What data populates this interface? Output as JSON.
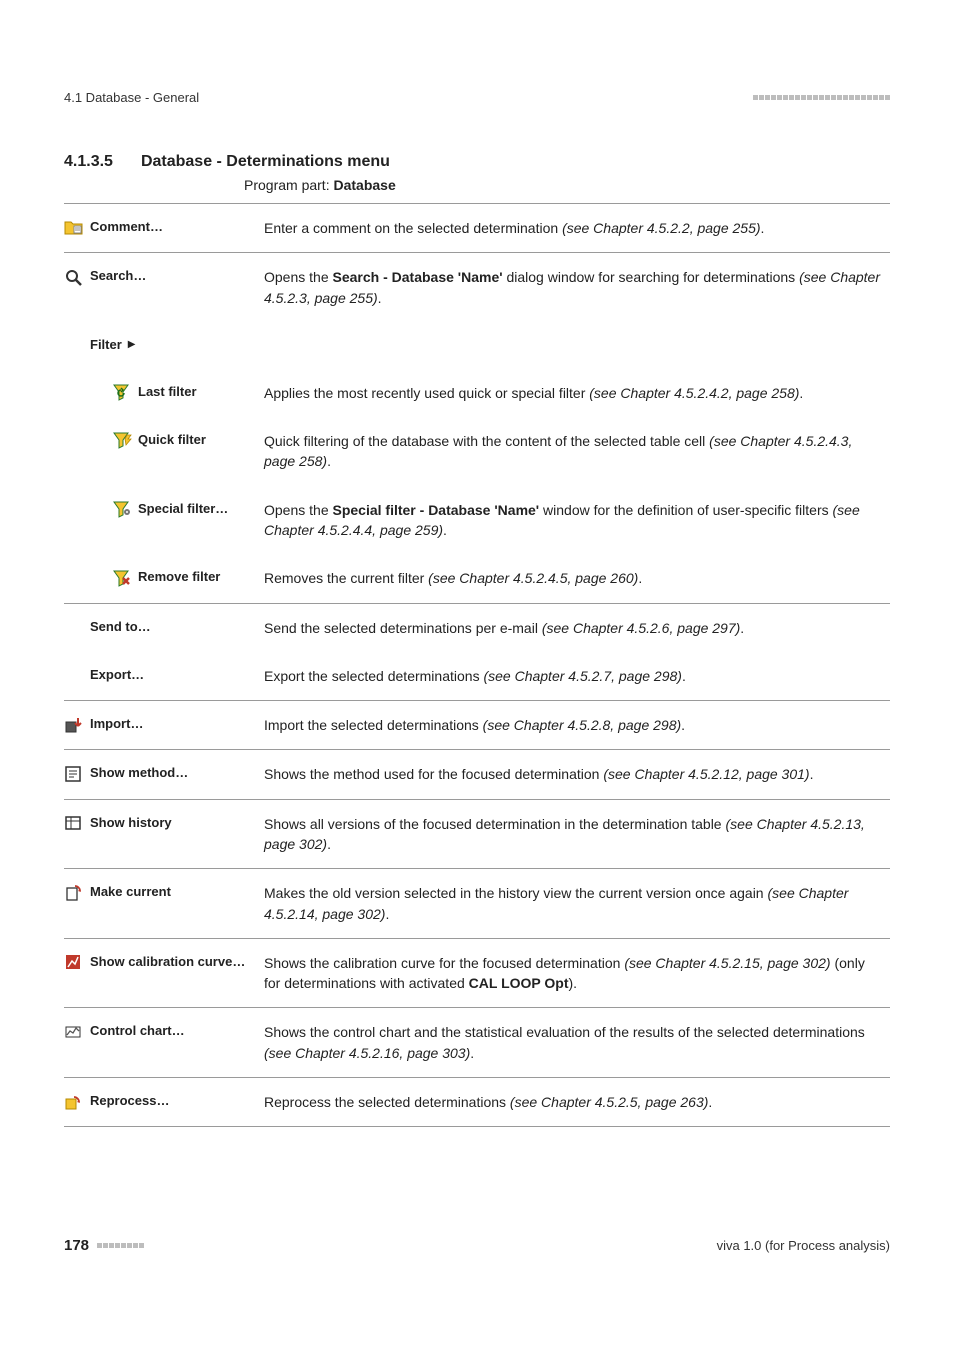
{
  "header": {
    "section_path": "4.1 Database - General"
  },
  "heading": {
    "number": "4.1.3.5",
    "title": "Database - Determinations menu"
  },
  "program_line": {
    "label": "Program part: ",
    "value": "Database"
  },
  "rows": [
    {
      "id": "comment",
      "label": "Comment…",
      "icon": "folder-note",
      "indent": 0,
      "desc_pre": "Enter a comment on the selected determination ",
      "desc_ital": "(see Chapter 4.5.2.2, page 255)",
      "desc_post": "."
    },
    {
      "id": "search",
      "label": "Search…",
      "icon": "magnifier",
      "indent": 0,
      "desc_pre": "Opens the ",
      "desc_bold": "Search - Database 'Name'",
      "desc_mid": " dialog window for searching for determinations ",
      "desc_ital": "(see Chapter 4.5.2.3, page 255)",
      "desc_post": "."
    },
    {
      "id": "filter",
      "label": "Filter ",
      "icon": "",
      "indent": 1,
      "triangle": true,
      "desc_pre": ""
    },
    {
      "id": "lastfilter",
      "label": "Last filter",
      "icon": "funnel-redo",
      "indent": 2,
      "desc_pre": "Applies the most recently used quick or special filter ",
      "desc_ital": "(see Chapter 4.5.2.4.2, page 258)",
      "desc_post": "."
    },
    {
      "id": "quickfilter",
      "label": "Quick filter",
      "icon": "funnel-bolt",
      "indent": 2,
      "desc_pre": "Quick filtering of the database with the content of the selected table cell ",
      "desc_ital": "(see Chapter 4.5.2.4.3, page 258)",
      "desc_post": "."
    },
    {
      "id": "specialfilter",
      "label": "Special filter…",
      "icon": "funnel-gear",
      "indent": 2,
      "desc_pre": "Opens the ",
      "desc_bold": "Special filter - Database 'Name'",
      "desc_mid": " window for the definition of user-specific filters ",
      "desc_ital": "(see Chapter 4.5.2.4.4, page 259)",
      "desc_post": "."
    },
    {
      "id": "removefilter",
      "label": "Remove filter",
      "icon": "funnel-x",
      "indent": 2,
      "desc_pre": "Removes the current filter ",
      "desc_ital": "(see Chapter 4.5.2.4.5, page 260)",
      "desc_post": "."
    },
    {
      "id": "sendto",
      "label": "Send to…",
      "icon": "",
      "indent": 1,
      "desc_pre": "Send the selected determinations per e-mail ",
      "desc_ital": "(see Chapter 4.5.2.6, page 297)",
      "desc_post": "."
    },
    {
      "id": "export",
      "label": "Export…",
      "icon": "",
      "indent": 1,
      "desc_pre": "Export the selected determinations ",
      "desc_ital": "(see Chapter 4.5.2.7, page 298)",
      "desc_post": "."
    },
    {
      "id": "import",
      "label": "Import…",
      "icon": "import",
      "indent": 0,
      "desc_pre": "Import the selected determinations ",
      "desc_ital": "(see Chapter 4.5.2.8, page 298)",
      "desc_post": "."
    },
    {
      "id": "showmethod",
      "label": "Show method…",
      "icon": "method",
      "indent": 0,
      "desc_pre": "Shows the method used for the focused determination ",
      "desc_ital": "(see Chapter 4.5.2.12, page 301)",
      "desc_post": "."
    },
    {
      "id": "showhistory",
      "label": "Show history",
      "icon": "history",
      "indent": 0,
      "desc_pre": "Shows all versions of the focused determination in the determination table ",
      "desc_ital": "(see Chapter 4.5.2.13, page 302)",
      "desc_post": "."
    },
    {
      "id": "makecurrent",
      "label": "Make current",
      "icon": "makecurrent",
      "indent": 0,
      "desc_pre": "Makes the old version selected in the history view the current version once again ",
      "desc_ital": "(see Chapter 4.5.2.14, page 302)",
      "desc_post": "."
    },
    {
      "id": "showcalib",
      "label": "Show calibration curve…",
      "icon": "calib",
      "indent": 0,
      "desc_pre": "Shows the calibration curve for the focused determination ",
      "desc_ital": "(see Chapter 4.5.2.15, page 302)",
      "desc_mid2": " (only for determinations with activated ",
      "desc_bold2": "CAL LOOP Opt",
      "desc_post": ")."
    },
    {
      "id": "controlchart",
      "label": "Control chart…",
      "icon": "chart",
      "indent": 0,
      "desc_pre": "Shows the control chart and the statistical evaluation of the results of the selected determinations ",
      "desc_ital": "(see Chapter 4.5.2.16, page 303)",
      "desc_post": "."
    },
    {
      "id": "reprocess",
      "label": "Reprocess…",
      "icon": "reprocess",
      "indent": 0,
      "desc_pre": "Reprocess the selected determinations ",
      "desc_ital": "(see Chapter 4.5.2.5, page 263)",
      "desc_post": "."
    }
  ],
  "footer": {
    "page": "178",
    "doc": "viva 1.0 (for Process analysis)"
  },
  "separators": [
    "comment",
    "search",
    "import",
    "showmethod",
    "showhistory",
    "makecurrent",
    "showcalib",
    "controlchart",
    "reprocess",
    "sendto"
  ]
}
